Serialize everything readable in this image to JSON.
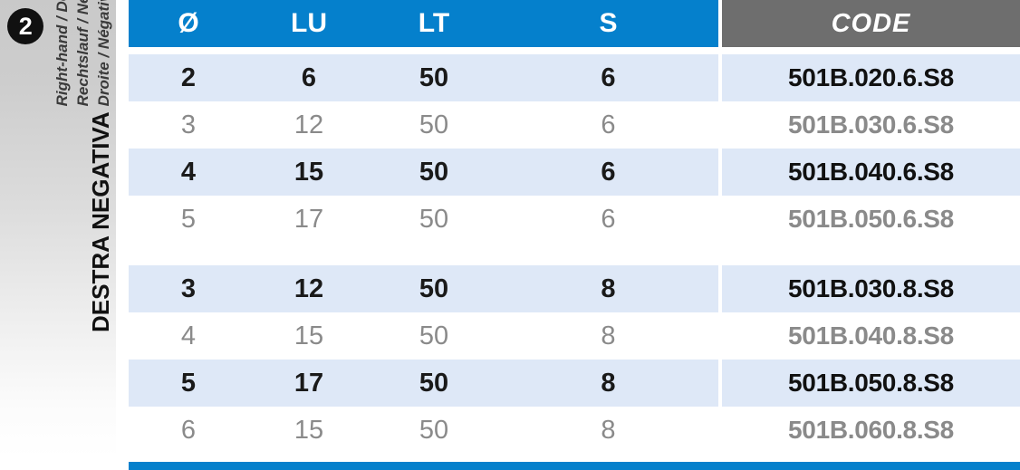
{
  "side_panel": {
    "badge_number": "2",
    "title": "DESTRA NEGATIVA",
    "subtitles": [
      "Right-hand / Down-cut",
      "Rechtslauf / Negative",
      "Droite / Négatives"
    ]
  },
  "table": {
    "headers": {
      "diameter": "Ø",
      "lu": "LU",
      "lt": "LT",
      "s": "S",
      "code": "CODE"
    },
    "groups": [
      {
        "rows": [
          {
            "diameter": "2",
            "lu": "6",
            "lt": "50",
            "s": "6",
            "code": "501B.020.6.S8",
            "highlight": true
          },
          {
            "diameter": "3",
            "lu": "12",
            "lt": "50",
            "s": "6",
            "code": "501B.030.6.S8",
            "highlight": false
          },
          {
            "diameter": "4",
            "lu": "15",
            "lt": "50",
            "s": "6",
            "code": "501B.040.6.S8",
            "highlight": true
          },
          {
            "diameter": "5",
            "lu": "17",
            "lt": "50",
            "s": "6",
            "code": "501B.050.6.S8",
            "highlight": false
          }
        ]
      },
      {
        "rows": [
          {
            "diameter": "3",
            "lu": "12",
            "lt": "50",
            "s": "8",
            "code": "501B.030.8.S8",
            "highlight": true
          },
          {
            "diameter": "4",
            "lu": "15",
            "lt": "50",
            "s": "8",
            "code": "501B.040.8.S8",
            "highlight": false
          },
          {
            "diameter": "5",
            "lu": "17",
            "lt": "50",
            "s": "8",
            "code": "501B.050.8.S8",
            "highlight": true
          },
          {
            "diameter": "6",
            "lu": "15",
            "lt": "50",
            "s": "8",
            "code": "501B.060.8.S8",
            "highlight": false
          }
        ]
      }
    ]
  },
  "colors": {
    "header_blue": "#0580cc",
    "header_gray": "#6e6e6e",
    "row_highlight": "#dee8f7",
    "row_plain": "#ffffff",
    "text_dark": "#1a1a1a",
    "text_muted": "#8a8a8a",
    "panel_gradient_top": "#c9c9c9",
    "panel_gradient_bottom": "#ffffff"
  }
}
